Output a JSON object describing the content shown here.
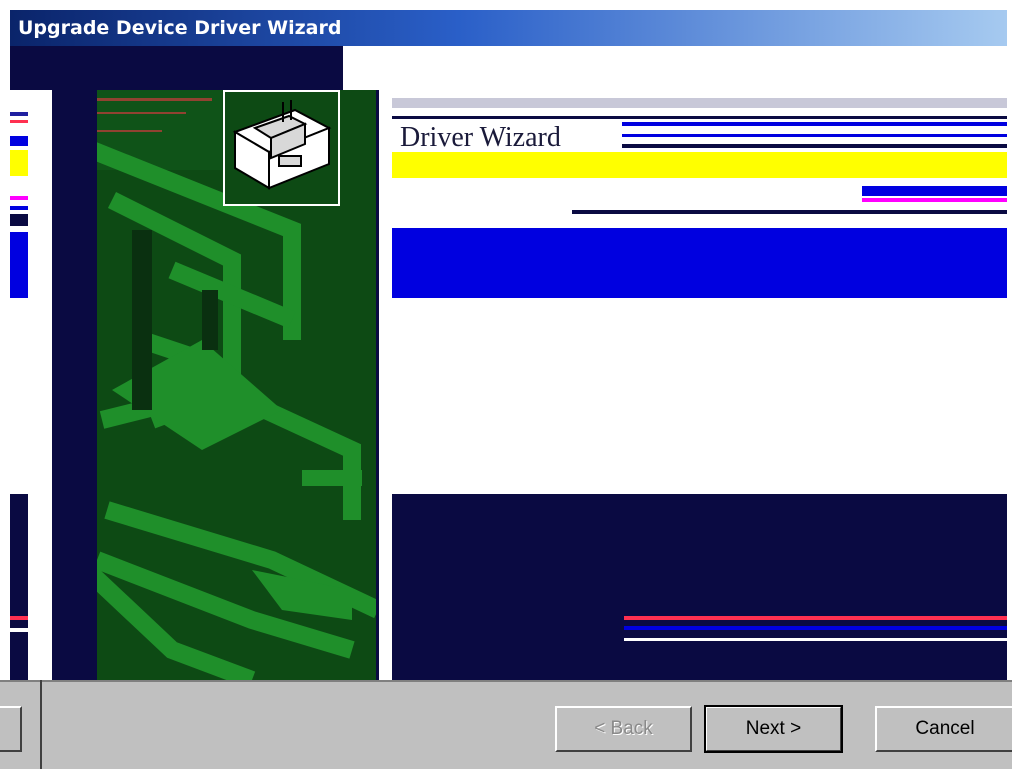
{
  "window": {
    "title": "Upgrade Device Driver Wizard"
  },
  "wizard": {
    "heading": "Driver Wizard",
    "subtitle": "",
    "continue_text": ""
  },
  "buttons": {
    "back_label": "< Back",
    "next_label": "Next >",
    "cancel_label": "Cancel"
  },
  "colors": {
    "title_gradient_start": "#0a246a",
    "art_green": "#0d4a14",
    "art_bright_green": "#1f8f2a",
    "band_blue": "#0000e0",
    "band_yellow": "#ffff00",
    "band_navy": "#0a0a42",
    "band_magenta": "#ff00ff",
    "dialog_face": "#c0c0c0"
  },
  "icons": {
    "illustration": "hardware-drawer-icon"
  }
}
